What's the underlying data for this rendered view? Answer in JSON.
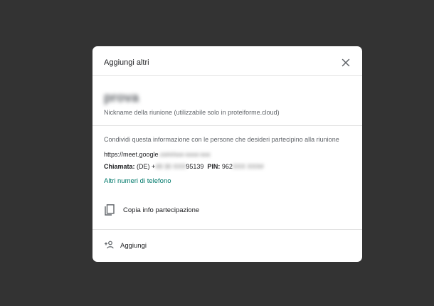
{
  "dialog": {
    "title": "Aggiungi altri",
    "close_icon": "close-icon"
  },
  "nickname": {
    "value": "prova",
    "hint": "Nickname della riunione (utilizzabile solo in proteiforme.cloud)"
  },
  "share": {
    "intro": "Condividi questa informazione con le persone che desideri partecipino alla riunione",
    "link_prefix": "https://meet.google",
    "link_blurred": ".com/xxx-xxxx-xxx",
    "call_label": "Chiamata:",
    "call_country": "(DE)",
    "call_prefix": "+",
    "call_number_blurred": "49 30 XXX",
    "call_number_visible": "95139",
    "pin_label": "PIN:",
    "pin_visible": "962",
    "pin_blurred": "XXX XXX#",
    "more_numbers": "Altri numeri di telefono"
  },
  "copy": {
    "icon": "copy-icon",
    "label": "Copia info partecipazione"
  },
  "add": {
    "icon": "person-add-icon",
    "label": "Aggiungi"
  }
}
